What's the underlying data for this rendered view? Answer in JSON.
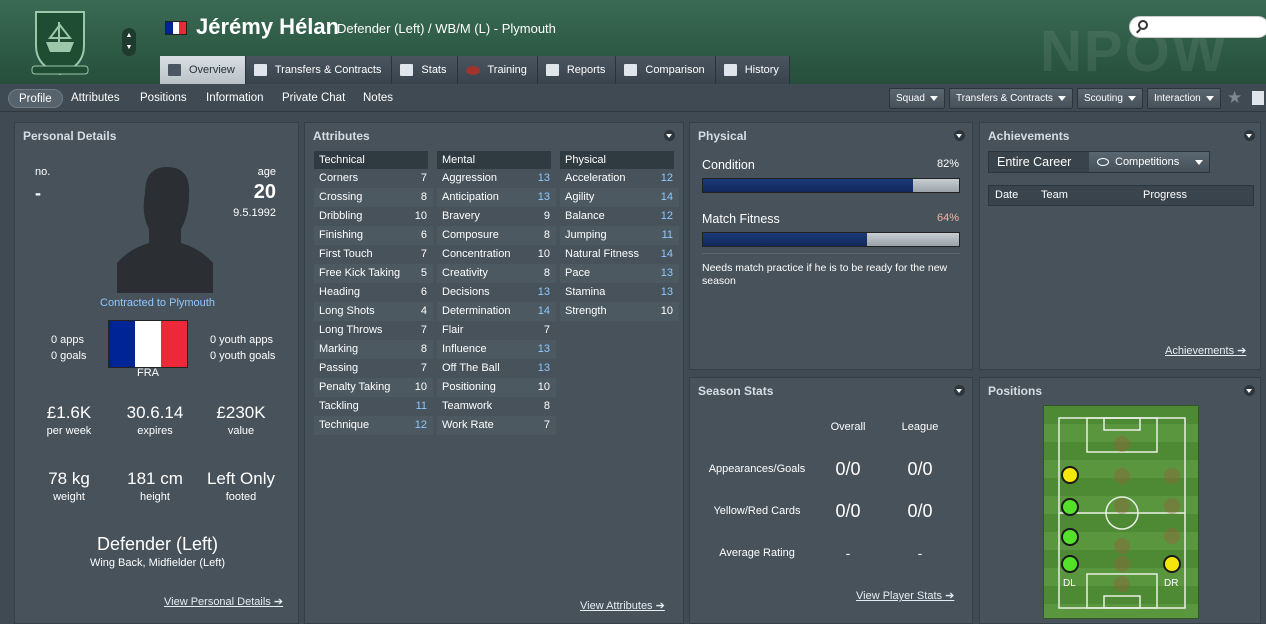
{
  "header": {
    "player_name": "Jérémy Hélan",
    "player_sub": "Defender (Left) / WB/M (L) - Plymouth",
    "watermark": "NPOW",
    "search_placeholder": "",
    "flag_colors": [
      "#002395",
      "#ffffff",
      "#ed2939"
    ]
  },
  "tabs": [
    {
      "label": "Overview",
      "icon": "overview-icon"
    },
    {
      "label": "Transfers & Contracts",
      "icon": "document-icon"
    },
    {
      "label": "Stats",
      "icon": "stats-icon"
    },
    {
      "label": "Training",
      "icon": "rugby-ball-icon"
    },
    {
      "label": "Reports",
      "icon": "report-icon"
    },
    {
      "label": "Comparison",
      "icon": "comparison-icon"
    },
    {
      "label": "History",
      "icon": "history-icon"
    }
  ],
  "subnav": {
    "items": [
      "Profile",
      "Attributes",
      "Positions",
      "Information",
      "Private Chat",
      "Notes"
    ],
    "dropdowns": [
      "Squad",
      "Transfers & Contracts",
      "Scouting",
      "Interaction"
    ]
  },
  "personal": {
    "title": "Personal Details",
    "no_label": "no.",
    "no_value": "-",
    "age_label": "age",
    "age_value": "20",
    "dob": "9.5.1992",
    "contract": "Contracted to Plymouth",
    "apps": "0 apps",
    "goals": "0 goals",
    "youth_apps": "0 youth apps",
    "youth_goals": "0 youth goals",
    "nation": "FRA",
    "wage": "£1.6K",
    "wage_label": "per week",
    "expires": "30.6.14",
    "expires_label": "expires",
    "value": "£230K",
    "value_label": "value",
    "weight": "78 kg",
    "weight_label": "weight",
    "height": "181 cm",
    "height_label": "height",
    "foot": "Left Only",
    "foot_label": "footed",
    "position": "Defender (Left)",
    "position_sub": "Wing Back, Midfielder (Left)",
    "link": "View Personal Details"
  },
  "attributes": {
    "title": "Attributes",
    "technical_label": "Technical",
    "mental_label": "Mental",
    "physical_label": "Physical",
    "technical": [
      {
        "name": "Corners",
        "value": "7"
      },
      {
        "name": "Crossing",
        "value": "8"
      },
      {
        "name": "Dribbling",
        "value": "10"
      },
      {
        "name": "Finishing",
        "value": "6"
      },
      {
        "name": "First Touch",
        "value": "7"
      },
      {
        "name": "Free Kick Taking",
        "value": "5"
      },
      {
        "name": "Heading",
        "value": "6"
      },
      {
        "name": "Long Shots",
        "value": "4"
      },
      {
        "name": "Long Throws",
        "value": "7"
      },
      {
        "name": "Marking",
        "value": "8"
      },
      {
        "name": "Passing",
        "value": "7"
      },
      {
        "name": "Penalty Taking",
        "value": "10"
      },
      {
        "name": "Tackling",
        "value": "11"
      },
      {
        "name": "Technique",
        "value": "12"
      }
    ],
    "mental": [
      {
        "name": "Aggression",
        "value": "13"
      },
      {
        "name": "Anticipation",
        "value": "13"
      },
      {
        "name": "Bravery",
        "value": "9"
      },
      {
        "name": "Composure",
        "value": "8"
      },
      {
        "name": "Concentration",
        "value": "10"
      },
      {
        "name": "Creativity",
        "value": "8"
      },
      {
        "name": "Decisions",
        "value": "13"
      },
      {
        "name": "Determination",
        "value": "14"
      },
      {
        "name": "Flair",
        "value": "7"
      },
      {
        "name": "Influence",
        "value": "13"
      },
      {
        "name": "Off The Ball",
        "value": "13"
      },
      {
        "name": "Positioning",
        "value": "10"
      },
      {
        "name": "Teamwork",
        "value": "8"
      },
      {
        "name": "Work Rate",
        "value": "7"
      }
    ],
    "physical": [
      {
        "name": "Acceleration",
        "value": "12"
      },
      {
        "name": "Agility",
        "value": "14"
      },
      {
        "name": "Balance",
        "value": "12"
      },
      {
        "name": "Jumping",
        "value": "11"
      },
      {
        "name": "Natural Fitness",
        "value": "14"
      },
      {
        "name": "Pace",
        "value": "13"
      },
      {
        "name": "Stamina",
        "value": "13"
      },
      {
        "name": "Strength",
        "value": "10"
      }
    ],
    "link": "View Attributes"
  },
  "physical": {
    "title": "Physical",
    "condition_label": "Condition",
    "condition_value": "82%",
    "condition_fraction": 0.82,
    "fitness_label": "Match Fitness",
    "fitness_value": "64%",
    "fitness_fraction": 0.64,
    "note": "Needs match practice if he is to be ready for the new season"
  },
  "achievements": {
    "title": "Achievements",
    "entire_career": "Entire Career",
    "competitions": "Competitions",
    "columns": [
      "Date",
      "Team",
      "Progress"
    ],
    "link": "Achievements"
  },
  "season": {
    "title": "Season Stats",
    "col_overall": "Overall",
    "col_league": "League",
    "rows": [
      {
        "label": "Appearances/Goals",
        "overall": "0/0",
        "league": "0/0"
      },
      {
        "label": "Yellow/Red Cards",
        "overall": "0/0",
        "league": "0/0"
      },
      {
        "label": "Average Rating",
        "overall": "-",
        "league": "-"
      }
    ],
    "link": "View Player Stats"
  },
  "positions": {
    "title": "Positions",
    "label_dl": "DL",
    "label_dr": "DR",
    "colors": {
      "natural": "#55e02a",
      "accomplished": "#f5e60c"
    }
  }
}
